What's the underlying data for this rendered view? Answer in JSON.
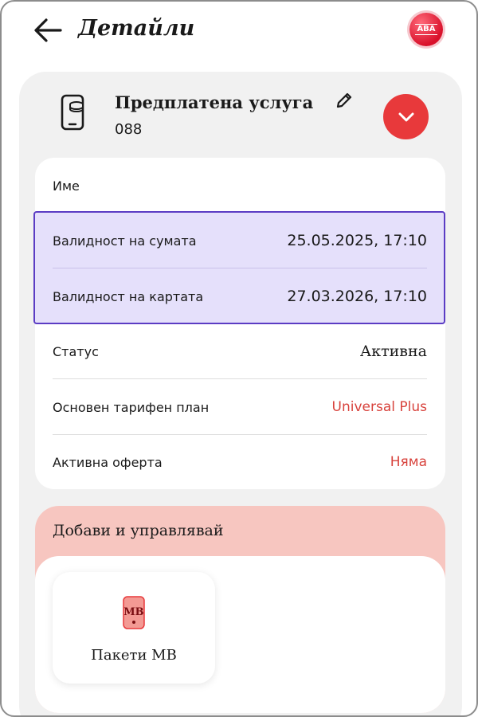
{
  "header": {
    "title": "Детайли",
    "logo_text": "ABA"
  },
  "service": {
    "title": "Предплатена услуга",
    "number": "088"
  },
  "details": {
    "name_label": "Име",
    "amount_validity_label": "Валидност на сумата",
    "amount_validity_value": "25.05.2025, 17:10",
    "card_validity_label": "Валидност на картата",
    "card_validity_value": "27.03.2026, 17:10",
    "status_label": "Статус",
    "status_value": "Активна",
    "plan_label": "Основен тарифен план",
    "plan_value": "Universal Plus",
    "offer_label": "Активна оферта",
    "offer_value": "Няма"
  },
  "manage": {
    "title": "Добави и управлявай",
    "tiles": [
      {
        "label": "Пакети MB",
        "icon_text": "MB"
      }
    ]
  },
  "colors": {
    "accent_red": "#e8393b",
    "value_red": "#d8433d",
    "highlight_bg": "#e5e0fb",
    "highlight_border": "#5b3cc4",
    "manage_bg": "#f7c6c0"
  }
}
